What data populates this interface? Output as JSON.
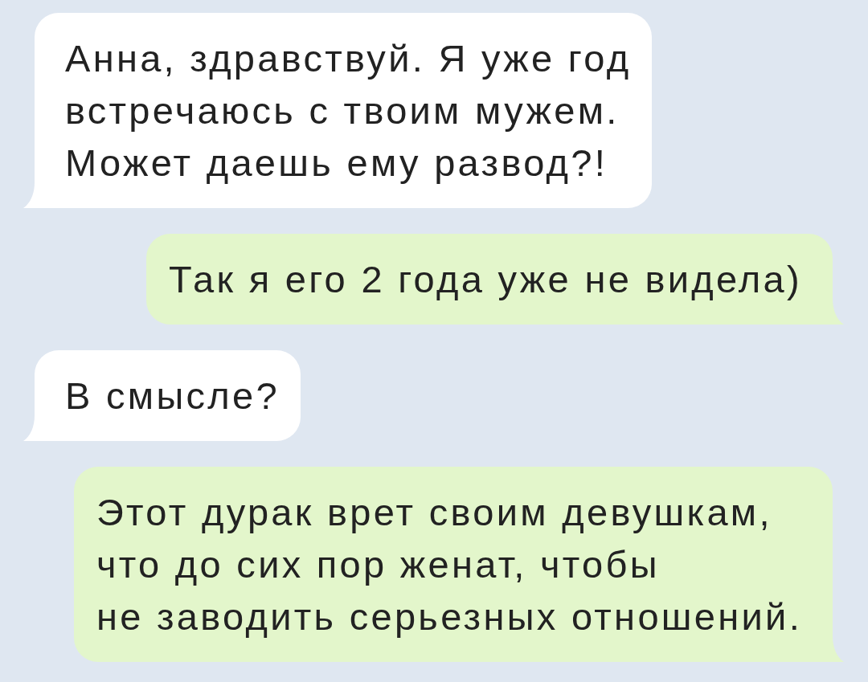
{
  "messages": [
    {
      "kind": "incoming",
      "lines": [
        "Анна, здравствуй. Я уже год",
        "встречаюсь с твоим мужем.",
        "Может даешь ему развод?!"
      ]
    },
    {
      "kind": "outgoing",
      "lines": [
        "Так я его 2 года уже не видела)"
      ]
    },
    {
      "kind": "incoming",
      "lines": [
        "В смысле?"
      ]
    },
    {
      "kind": "outgoing",
      "lines": [
        "Этот дурак врет своим девушкам,",
        "что до сих пор женат, чтобы",
        "не заводить серьезных отношений."
      ]
    }
  ]
}
